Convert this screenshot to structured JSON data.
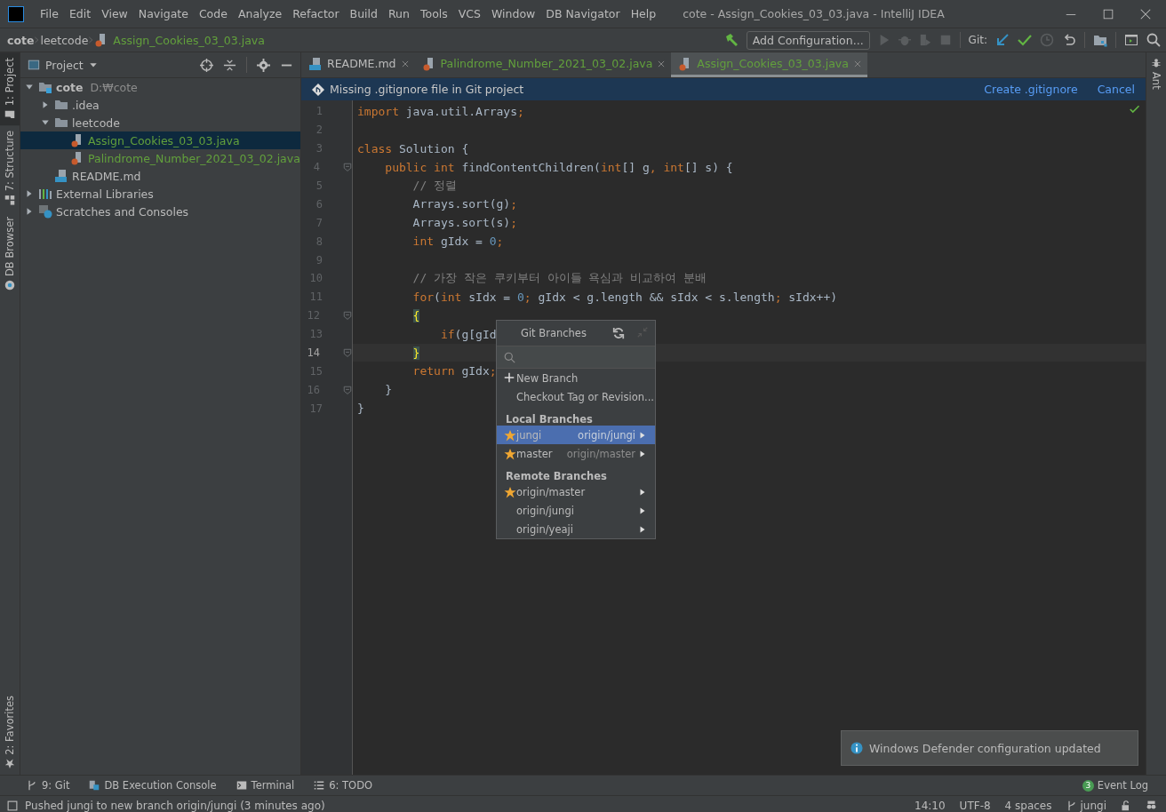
{
  "window": {
    "title": "cote - Assign_Cookies_03_03.java - IntelliJ IDEA"
  },
  "menu": [
    "File",
    "Edit",
    "View",
    "Navigate",
    "Code",
    "Analyze",
    "Refactor",
    "Build",
    "Run",
    "Tools",
    "VCS",
    "Window",
    "DB Navigator",
    "Help"
  ],
  "breadcrumbs": [
    {
      "label": "cote",
      "kind": "project"
    },
    {
      "label": "leetcode",
      "kind": "folder"
    },
    {
      "label": "Assign_Cookies_03_03.java",
      "kind": "java"
    }
  ],
  "toolbar": {
    "run_config": "Add Configuration...",
    "git_label": "Git:"
  },
  "left_stripe": [
    {
      "label": "1: Project",
      "kind": "project",
      "selected": true
    },
    {
      "label": "7: Structure",
      "kind": "structure",
      "selected": false
    },
    {
      "label": "DB Browser",
      "kind": "db",
      "selected": false
    }
  ],
  "left_stripe_bottom": [
    {
      "label": "2: Favorites",
      "kind": "favorites",
      "selected": false
    }
  ],
  "right_stripe": [
    {
      "label": "Ant"
    }
  ],
  "project": {
    "title": "Project",
    "tree": [
      {
        "label": "cote",
        "hint": "D:₩cote",
        "kind": "module",
        "expanded": true,
        "selected": false,
        "children": [
          {
            "label": ".idea",
            "kind": "folder",
            "expanded": false,
            "selected": false
          },
          {
            "label": "leetcode",
            "kind": "folder",
            "expanded": true,
            "selected": false,
            "children": [
              {
                "label": "Assign_Cookies_03_03.java",
                "kind": "java",
                "selected": true,
                "vcs_added": true
              },
              {
                "label": "Palindrome_Number_2021_03_02.java",
                "kind": "java",
                "selected": false,
                "vcs_added": true
              }
            ]
          },
          {
            "label": "README.md",
            "kind": "md",
            "selected": false,
            "vcs_added": false
          }
        ]
      },
      {
        "label": "External Libraries",
        "kind": "libraries",
        "expanded": false,
        "selected": false
      },
      {
        "label": "Scratches and Consoles",
        "kind": "scratches",
        "expanded": false,
        "selected": false
      }
    ]
  },
  "tabs": [
    {
      "label": "README.md",
      "kind": "md",
      "selected": false,
      "vcs_added": false
    },
    {
      "label": "Palindrome_Number_2021_03_02.java",
      "kind": "java",
      "selected": false,
      "vcs_added": true
    },
    {
      "label": "Assign_Cookies_03_03.java",
      "kind": "java",
      "selected": true,
      "vcs_added": true
    }
  ],
  "banner": {
    "text": "Missing .gitignore file in Git project",
    "actions": [
      "Create .gitignore",
      "Cancel"
    ]
  },
  "code": [
    {
      "number": "1",
      "fold": false,
      "current": false,
      "tokens": [
        {
          "kind": "keyword",
          "text": "import"
        },
        {
          "kind": "plain",
          "text": " java.util.Arrays"
        },
        {
          "kind": "keyword",
          "text": ";"
        }
      ]
    },
    {
      "number": "2",
      "fold": false,
      "current": false
    },
    {
      "number": "3",
      "fold": false,
      "current": false,
      "tokens": [
        {
          "kind": "keyword",
          "text": "class"
        },
        {
          "kind": "plain",
          "text": " Solution {"
        }
      ]
    },
    {
      "number": "4",
      "fold": true,
      "current": false,
      "tokens": [
        {
          "kind": "keyword",
          "text": "    public int"
        },
        {
          "kind": "plain",
          "text": " findContentChildren("
        },
        {
          "kind": "keyword",
          "text": "int"
        },
        {
          "kind": "plain",
          "text": "[] g"
        },
        {
          "kind": "keyword",
          "text": ", int"
        },
        {
          "kind": "plain",
          "text": "[] s) {"
        }
      ]
    },
    {
      "number": "5",
      "fold": false,
      "current": false,
      "tokens": [
        {
          "kind": "comment",
          "text": "        // 정렬"
        }
      ]
    },
    {
      "number": "6",
      "fold": false,
      "current": false,
      "tokens": [
        {
          "kind": "plain",
          "text": "        Arrays.sort(g)"
        },
        {
          "kind": "keyword",
          "text": ";"
        }
      ]
    },
    {
      "number": "7",
      "fold": false,
      "current": false,
      "tokens": [
        {
          "kind": "plain",
          "text": "        Arrays.sort(s)"
        },
        {
          "kind": "keyword",
          "text": ";"
        }
      ]
    },
    {
      "number": "8",
      "fold": false,
      "current": false,
      "tokens": [
        {
          "kind": "keyword",
          "text": "        int"
        },
        {
          "kind": "plain",
          "text": " gIdx = "
        },
        {
          "kind": "number",
          "text": "0"
        },
        {
          "kind": "keyword",
          "text": ";"
        }
      ]
    },
    {
      "number": "9",
      "fold": false,
      "current": false
    },
    {
      "number": "10",
      "fold": false,
      "current": false,
      "tokens": [
        {
          "kind": "comment",
          "text": "        // 가장 작은 쿠키부터 아이들 욕심과 비교하여 분배"
        }
      ]
    },
    {
      "number": "11",
      "fold": false,
      "current": false,
      "tokens": [
        {
          "kind": "keyword",
          "text": "        for"
        },
        {
          "kind": "plain",
          "text": "("
        },
        {
          "kind": "keyword",
          "text": "int"
        },
        {
          "kind": "plain",
          "text": " sIdx = "
        },
        {
          "kind": "number",
          "text": "0"
        },
        {
          "kind": "keyword",
          "text": ";"
        },
        {
          "kind": "plain",
          "text": " gIdx < g.length && sIdx < s.length"
        },
        {
          "kind": "keyword",
          "text": ";"
        },
        {
          "kind": "plain",
          "text": " sIdx++)"
        }
      ]
    },
    {
      "number": "12",
      "fold": true,
      "current": false,
      "tokens": [
        {
          "kind": "brace",
          "text": "{"
        }
      ]
    },
    {
      "number": "13",
      "fold": false,
      "current": false,
      "tokens": [
        {
          "kind": "keyword",
          "text": "            if"
        },
        {
          "kind": "plain",
          "text": "(g[gId"
        }
      ]
    },
    {
      "number": "14",
      "fold": true,
      "current": true,
      "tokens": [
        {
          "kind": "brace",
          "text": "}"
        }
      ]
    },
    {
      "number": "15",
      "fold": false,
      "current": false,
      "tokens": [
        {
          "kind": "keyword",
          "text": "        return"
        },
        {
          "kind": "plain",
          "text": " gIdx"
        },
        {
          "kind": "keyword",
          "text": ";"
        }
      ]
    },
    {
      "number": "16",
      "fold": true,
      "current": false,
      "tokens": [
        {
          "kind": "plain",
          "text": "    }"
        }
      ]
    },
    {
      "number": "17",
      "fold": false,
      "current": false,
      "tokens": [
        {
          "kind": "plain",
          "text": "}"
        }
      ]
    }
  ],
  "branches_popup": {
    "title": "Git Branches",
    "actions": [
      {
        "label": "New Branch",
        "kind": "new"
      },
      {
        "label": "Checkout Tag or Revision...",
        "kind": "checkout"
      }
    ],
    "sections": [
      {
        "title": "Local Branches",
        "items": [
          {
            "name": "jungi",
            "tracking": "origin/jungi",
            "favorite": true,
            "selected": true
          },
          {
            "name": "master",
            "tracking": "origin/master",
            "favorite": true,
            "selected": false
          }
        ]
      },
      {
        "title": "Remote Branches",
        "items": [
          {
            "name": "origin/master",
            "favorite": true,
            "selected": false
          },
          {
            "name": "origin/jungi",
            "favorite": false,
            "selected": false
          },
          {
            "name": "origin/yeaji",
            "favorite": false,
            "selected": false
          }
        ]
      }
    ]
  },
  "notification": {
    "text": "Windows Defender configuration updated"
  },
  "tool_windows": [
    {
      "label": "9: Git",
      "kind": "git"
    },
    {
      "label": "DB Execution Console",
      "kind": "db"
    },
    {
      "label": "Terminal",
      "kind": "terminal"
    },
    {
      "label": "6: TODO",
      "kind": "todo"
    }
  ],
  "event_log": {
    "label": "Event Log",
    "count": "3"
  },
  "status_bar": {
    "message": "Pushed jungi to new branch origin/jungi (3 minutes ago)",
    "position": "14:10",
    "encoding": "UTF-8",
    "indent": "4 spaces",
    "branch": "jungi"
  }
}
